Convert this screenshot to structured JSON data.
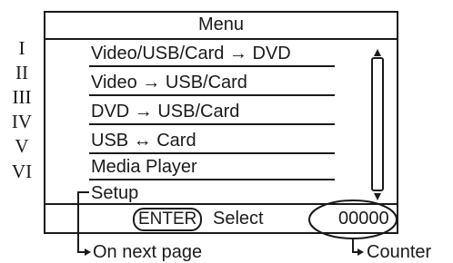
{
  "menu": {
    "title": "Menu",
    "items": [
      {
        "numeral": "I",
        "label": "Video/USB/Card → DVD"
      },
      {
        "numeral": "II",
        "label": "Video → USB/Card"
      },
      {
        "numeral": "III",
        "label": "DVD → USB/Card"
      },
      {
        "numeral": "IV",
        "label": "USB ↔ Card"
      },
      {
        "numeral": "V",
        "label": "Media Player"
      },
      {
        "numeral": "VI",
        "label": "Setup"
      }
    ],
    "footer": {
      "enter_key": "ENTER",
      "select_label": "Select",
      "counter": "00000"
    }
  },
  "annotations": {
    "next_page": "On next page",
    "counter": "Counter"
  }
}
